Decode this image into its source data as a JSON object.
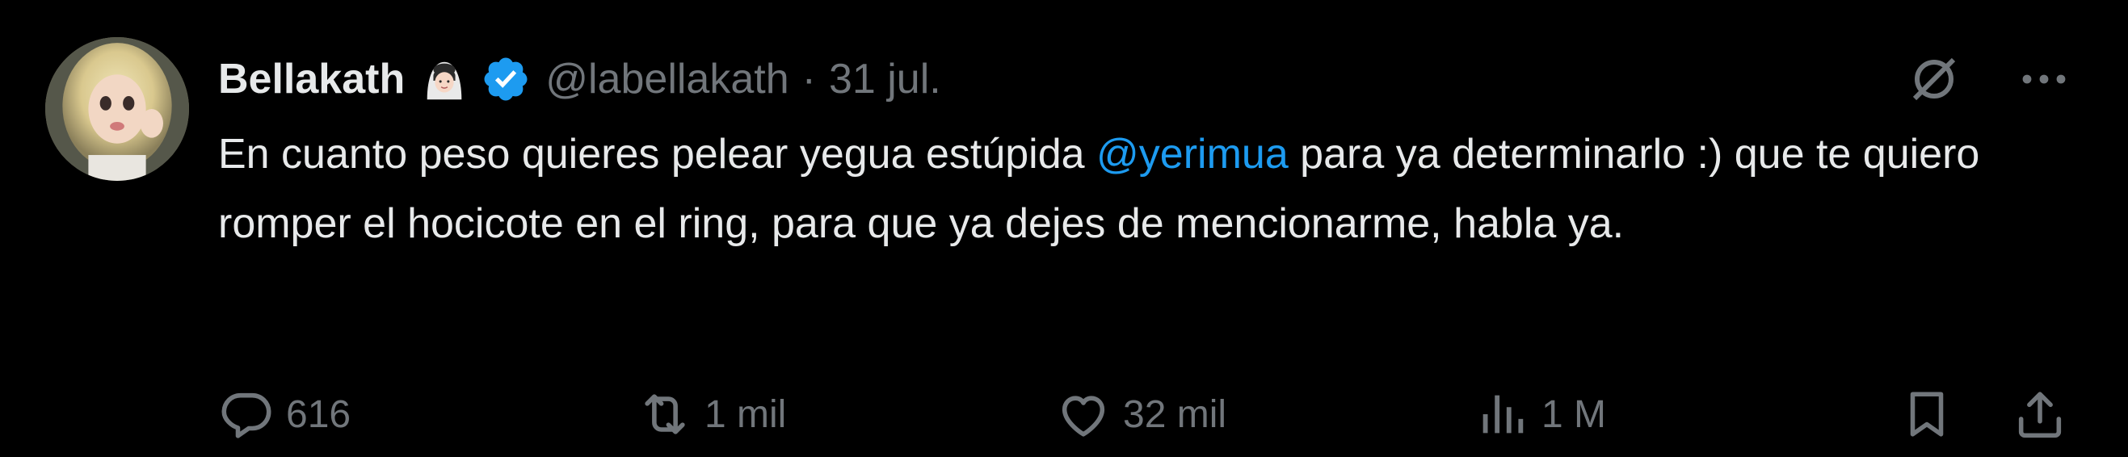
{
  "tweet": {
    "display_name": "Bellakath",
    "handle": "@labellakath",
    "separator": "·",
    "date": "31 jul.",
    "text_before_mention": "En cuanto peso quieres pelear yegua estúpida ",
    "mention": "@yerimua",
    "text_after_mention": " para ya determinarlo :) que te quiero romper el hocicote en el ring, para que ya dejes de mencionarme, habla ya."
  },
  "actions": {
    "replies": "616",
    "reposts": "1 mil",
    "likes": "32 mil",
    "views": "1 M"
  },
  "icons": {
    "top": [
      "grok-slash-icon",
      "more-icon"
    ],
    "verified": "verified-badge-icon",
    "emoji": "woman-with-veil-emoji",
    "actions": [
      "reply-icon",
      "repost-icon",
      "like-icon",
      "views-icon",
      "bookmark-icon",
      "share-icon"
    ]
  },
  "colors": {
    "background": "#000000",
    "text": "#e7e9ea",
    "secondary": "#71767b",
    "mention": "#1d9bf0",
    "verified": "#1d9bf0"
  }
}
